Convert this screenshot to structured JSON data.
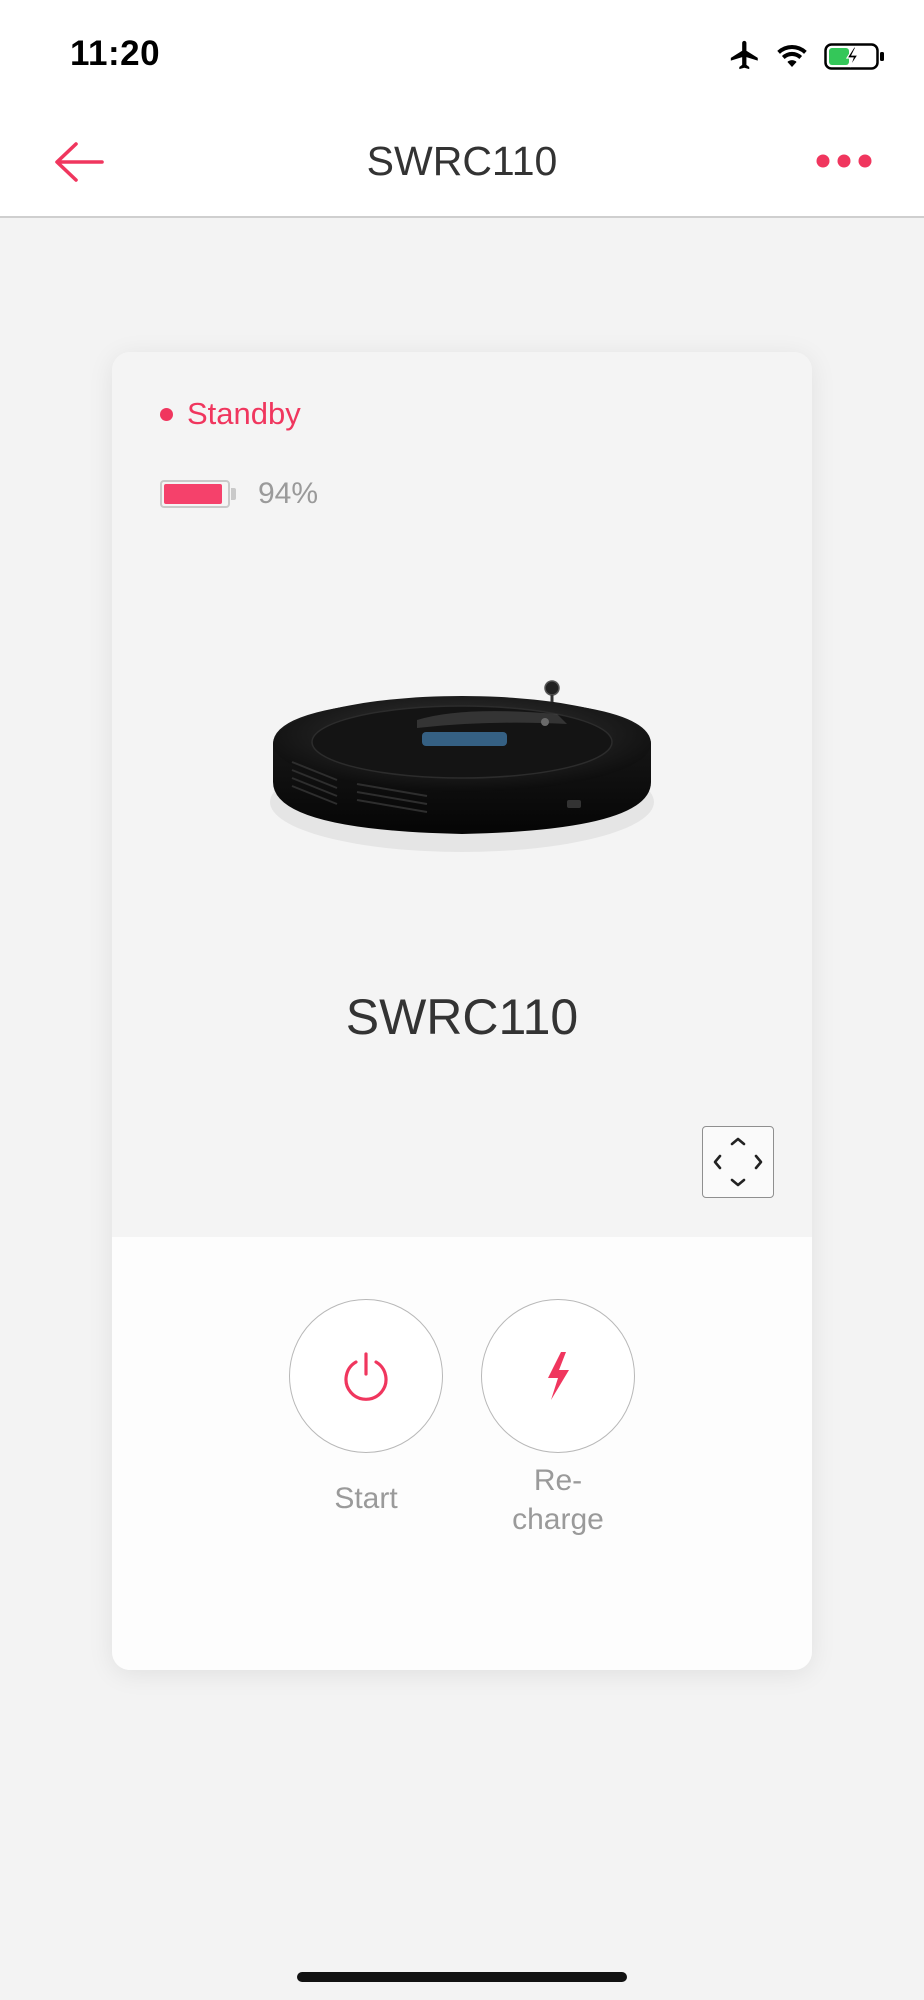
{
  "status_bar": {
    "time": "11:20",
    "icons": [
      "airplane-icon",
      "wifi-icon",
      "battery-charging-icon"
    ]
  },
  "nav": {
    "title": "SWRC110",
    "back_icon": "arrow-left-icon",
    "more_icon": "more-dots-icon",
    "accent_color": "#f0365e"
  },
  "device": {
    "status": "Standby",
    "battery_text": "94%",
    "battery_level": 0.94,
    "name": "SWRC110",
    "image": "robot-vacuum-image",
    "fullscreen_icon": "expand-arrows-icon"
  },
  "actions": [
    {
      "label": "Start",
      "icon": "power-icon"
    },
    {
      "label_line1": "Re-",
      "label_line2": "charge",
      "icon": "lightning-icon"
    }
  ],
  "colors": {
    "accent": "#f0365e",
    "background": "#f3f3f3",
    "card": "#f4f4f4",
    "muted_text": "#9a9a9a"
  }
}
